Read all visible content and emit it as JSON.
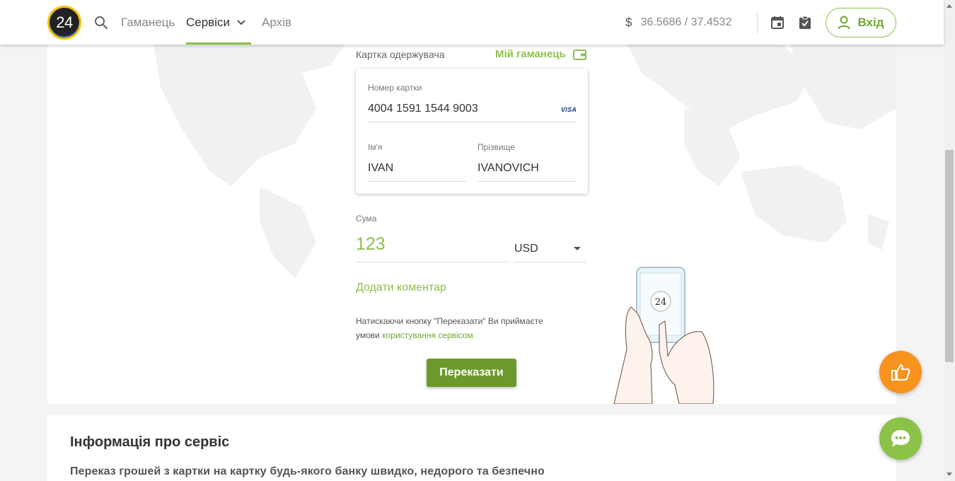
{
  "header": {
    "logo_text": "24",
    "nav": {
      "wallet": "Гаманець",
      "services": "Сервіси",
      "archive": "Архів"
    },
    "rate_symbol": "$",
    "rate": "36.5686 / 37.4532",
    "login": "Вхід",
    "icons": [
      "search-icon",
      "chevron-down-icon",
      "calendar-icon",
      "clipboard-check-icon",
      "user-icon"
    ]
  },
  "form": {
    "recipient_label": "Картка одержувача",
    "my_wallet": "Мій гаманець",
    "card_number_label": "Номер картки",
    "card_number": "4004 1591 1544 9003",
    "card_brand": "VISA",
    "first_name_label": "Ім'я",
    "first_name": "IVAN",
    "last_name_label": "Прізвище",
    "last_name": "IVANOVICH",
    "amount_label": "Сума",
    "amount": "123",
    "currency": "USD",
    "add_comment": "Додати коментар",
    "terms_text": "Натискаючи кнопку \"Переказати\" Ви приймаєте умови",
    "terms_link": "користування сервісом",
    "submit": "Переказати",
    "illustration_label": "24"
  },
  "info": {
    "title": "Інформація про сервіс",
    "text": "Переказ грошей з картки на картку будь-якого банку швидко, недорого та безпечно"
  },
  "colors": {
    "accent": "#8cc14a",
    "accent_dark": "#6b9a2a",
    "like_fab": "#f7931e",
    "chat_fab": "#8cc14a"
  }
}
